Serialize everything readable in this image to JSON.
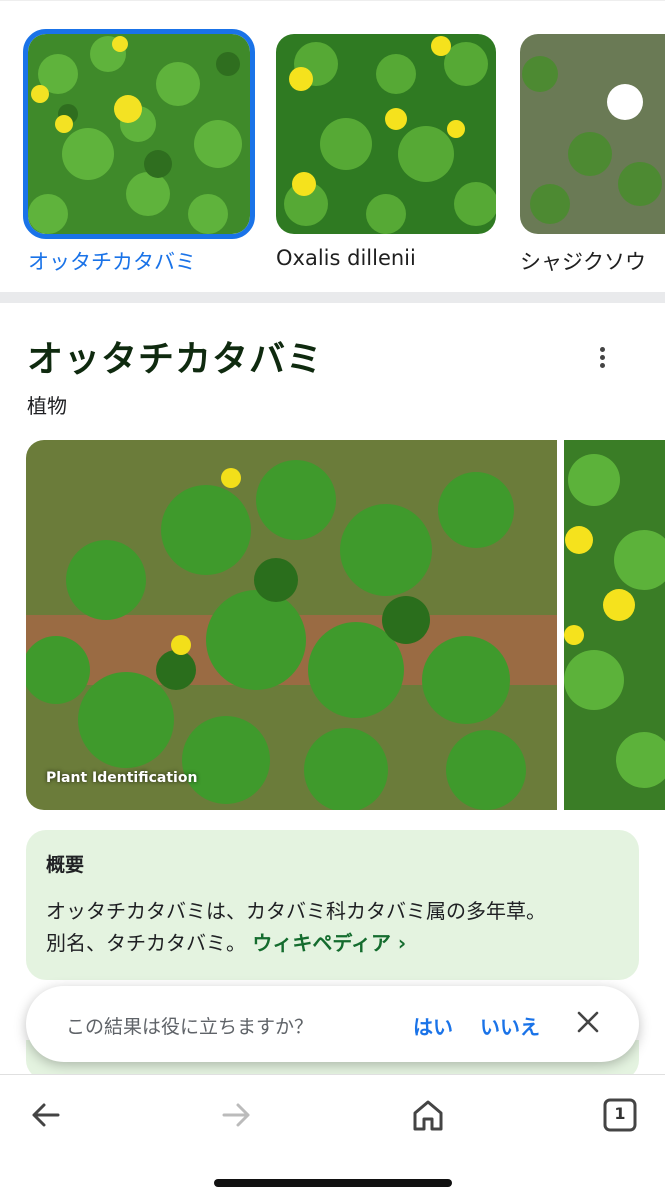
{
  "carousel": {
    "items": [
      {
        "label": "オッタチカタバミ",
        "selected": true
      },
      {
        "label": "Oxalis dillenii",
        "selected": false
      },
      {
        "label": "シャジクソウ",
        "selected": false
      }
    ]
  },
  "entity": {
    "title": "オッタチカタバミ",
    "subtitle": "植物",
    "image_caption": "Plant Identification"
  },
  "overview": {
    "heading": "概要",
    "text_line1": "オッタチカタバミは、カタバミ科カタバミ属の多年草。",
    "text_line2": "別名、タチカタバミ。",
    "link_label": "ウィキペディア ›"
  },
  "feedback": {
    "question": "この結果は役に立ちますか？",
    "yes_label": "はい",
    "no_label": "いいえ"
  },
  "bottom_nav": {
    "tab_count": "1"
  },
  "colors": {
    "accent": "#1a73e8",
    "overview_bg": "#e4f3e0",
    "link_green": "#146c2e"
  }
}
